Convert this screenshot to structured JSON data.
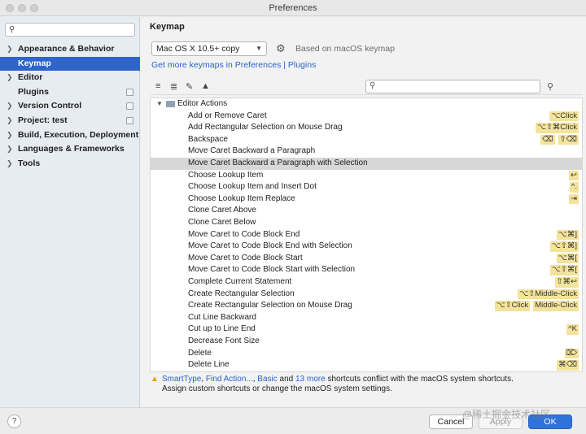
{
  "window": {
    "title": "Preferences"
  },
  "sidebar": {
    "search_placeholder": "",
    "items": [
      {
        "label": "Appearance & Behavior",
        "expandable": true
      },
      {
        "label": "Keymap",
        "expandable": false,
        "selected": true
      },
      {
        "label": "Editor",
        "expandable": true
      },
      {
        "label": "Plugins",
        "expandable": false,
        "badge": true
      },
      {
        "label": "Version Control",
        "expandable": true,
        "badge": true
      },
      {
        "label": "Project: test",
        "expandable": true,
        "badge": true
      },
      {
        "label": "Build, Execution, Deployment",
        "expandable": true
      },
      {
        "label": "Languages & Frameworks",
        "expandable": true
      },
      {
        "label": "Tools",
        "expandable": true
      }
    ]
  },
  "main": {
    "heading": "Keymap",
    "keymap_value": "Mac OS X 10.5+ copy",
    "based_on": "Based on macOS keymap",
    "get_more_link": "Get more keymaps in Preferences | Plugins",
    "tree_search_placeholder": "",
    "group_label": "Editor Actions",
    "actions": [
      {
        "name": "Add or Remove Caret",
        "shortcuts": [
          "⌥Click"
        ]
      },
      {
        "name": "Add Rectangular Selection on Mouse Drag",
        "shortcuts": [
          "⌥⇧⌘Click"
        ]
      },
      {
        "name": "Backspace",
        "shortcuts": [
          "⌫",
          "⇧⌫"
        ]
      },
      {
        "name": "Move Caret Backward a Paragraph",
        "shortcuts": []
      },
      {
        "name": "Move Caret Backward a Paragraph with Selection",
        "shortcuts": [],
        "selected": true
      },
      {
        "name": "Choose Lookup Item",
        "shortcuts": [
          "↩"
        ]
      },
      {
        "name": "Choose Lookup Item and Insert Dot",
        "shortcuts": [
          "^."
        ]
      },
      {
        "name": "Choose Lookup Item Replace",
        "shortcuts": [
          "⇥"
        ]
      },
      {
        "name": "Clone Caret Above",
        "shortcuts": []
      },
      {
        "name": "Clone Caret Below",
        "shortcuts": []
      },
      {
        "name": "Move Caret to Code Block End",
        "shortcuts": [
          "⌥⌘]"
        ]
      },
      {
        "name": "Move Caret to Code Block End with Selection",
        "shortcuts": [
          "⌥⇧⌘]"
        ]
      },
      {
        "name": "Move Caret to Code Block Start",
        "shortcuts": [
          "⌥⌘["
        ]
      },
      {
        "name": "Move Caret to Code Block Start with Selection",
        "shortcuts": [
          "⌥⇧⌘["
        ]
      },
      {
        "name": "Complete Current Statement",
        "shortcuts": [
          "⇧⌘↩"
        ]
      },
      {
        "name": "Create Rectangular Selection",
        "shortcuts": [
          "⌥⇧Middle-Click"
        ]
      },
      {
        "name": "Create Rectangular Selection on Mouse Drag",
        "shortcuts": [
          "⌥⇧Click",
          "Middle-Click"
        ]
      },
      {
        "name": "Cut Line Backward",
        "shortcuts": []
      },
      {
        "name": "Cut up to Line End",
        "shortcuts": [
          "^K"
        ]
      },
      {
        "name": "Decrease Font Size",
        "shortcuts": []
      },
      {
        "name": "Delete",
        "shortcuts": [
          "⌦"
        ]
      },
      {
        "name": "Delete Line",
        "shortcuts": [
          "⌘⌫"
        ]
      }
    ],
    "warning": {
      "links": [
        "SmartType",
        "Find Action...",
        "Basic",
        "13 more"
      ],
      "sep1": ", ",
      "sep2": ", ",
      "and_text": " and ",
      "suffix": " shortcuts conflict with the macOS system shortcuts.",
      "line2": "Assign custom shortcuts or change the macOS system settings."
    }
  },
  "footer": {
    "help_label": "?",
    "cancel": "Cancel",
    "apply": "Apply",
    "ok": "OK",
    "watermark": "@稀土掘金技术社区"
  },
  "colors": {
    "accent": "#2f65ca",
    "shortcut_bg": "#f4e39a",
    "link": "#2a64c8",
    "warning": "#e2a000"
  }
}
